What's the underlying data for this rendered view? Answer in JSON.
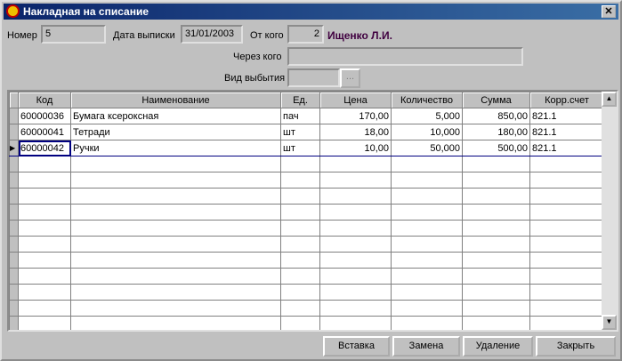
{
  "window": {
    "title": "Накладная на списание",
    "close": "✕"
  },
  "form": {
    "number_label": "Номер",
    "number": "5",
    "date_label": "Дата выписки",
    "date": "31/01/2003",
    "from_label": "От кого",
    "from_id": "2",
    "from_name": "Ищенко Л.И.",
    "via_label": "Через кого",
    "via": "",
    "type_label": "Вид выбытия",
    "type": "",
    "browse": "..."
  },
  "table": {
    "columns": [
      "Код",
      "Наименование",
      "Ед.",
      "Цена",
      "Количество",
      "Сумма",
      "Корр.счет"
    ],
    "rows": [
      [
        "60000036",
        "Бумага ксероксная",
        "пач",
        "170,00",
        "5,000",
        "850,00",
        "821.1"
      ],
      [
        "60000041",
        "Тетради",
        "шт",
        "18,00",
        "10,000",
        "180,00",
        "821.1"
      ],
      [
        "60000042",
        "Ручки",
        "шт",
        "10,00",
        "50,000",
        "500,00",
        "821.1"
      ]
    ],
    "selected_row": 2
  },
  "buttons": {
    "insert": "Вставка",
    "replace": "Замена",
    "delete": "Удаление",
    "close": "Закрыть"
  }
}
